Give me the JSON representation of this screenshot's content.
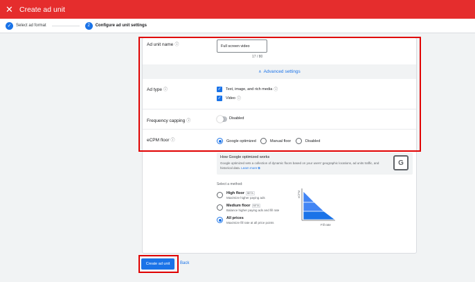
{
  "header": {
    "close_icon": "close-icon",
    "title": "Create ad unit"
  },
  "stepper": {
    "steps": [
      {
        "label": "Select ad format",
        "state": "done"
      },
      {
        "label": "Configure ad unit settings",
        "number": "2",
        "state": "current"
      }
    ]
  },
  "form": {
    "ad_unit_name": {
      "label": "Ad unit name",
      "value": "Full screen video",
      "counter": "17 / 80"
    },
    "advanced_settings": "Advanced settings",
    "ad_type": {
      "label": "Ad type",
      "options": [
        {
          "label": "Text, image, and rich media",
          "checked": true
        },
        {
          "label": "Video",
          "checked": true
        }
      ]
    },
    "frequency_capping": {
      "label": "Frequency capping",
      "state_label": "Disabled",
      "enabled": false
    },
    "ecpm_floor": {
      "label": "eCPM floor",
      "options": [
        {
          "label": "Google optimized",
          "selected": true
        },
        {
          "label": "Manual floor",
          "selected": false
        },
        {
          "label": "Disabled",
          "selected": false
        }
      ]
    },
    "info": {
      "title": "How Google optimized works",
      "text": "Google optimized sets a collection of dynamic floors based on your users' geographic locations, ad units traffic, and historical data.",
      "link": "Learn more"
    },
    "method": {
      "title": "Select a method:",
      "options": [
        {
          "title": "High floor",
          "badge": "BETA",
          "sub": "Maximize higher paying ads",
          "selected": false
        },
        {
          "title": "Medium floor",
          "badge": "BETA",
          "sub": "Balance higher paying ads and fill rate",
          "selected": false
        },
        {
          "title": "All prices",
          "badge": "",
          "sub": "Maximize fill rate at all price points",
          "selected": true
        }
      ],
      "chart_y_label": "eCPM",
      "chart_x_label": "Fill rate"
    }
  },
  "footer": {
    "create_label": "Create ad unit",
    "back_label": "Back"
  },
  "colors": {
    "header": "#e52d2d",
    "accent": "#1a73e8"
  }
}
